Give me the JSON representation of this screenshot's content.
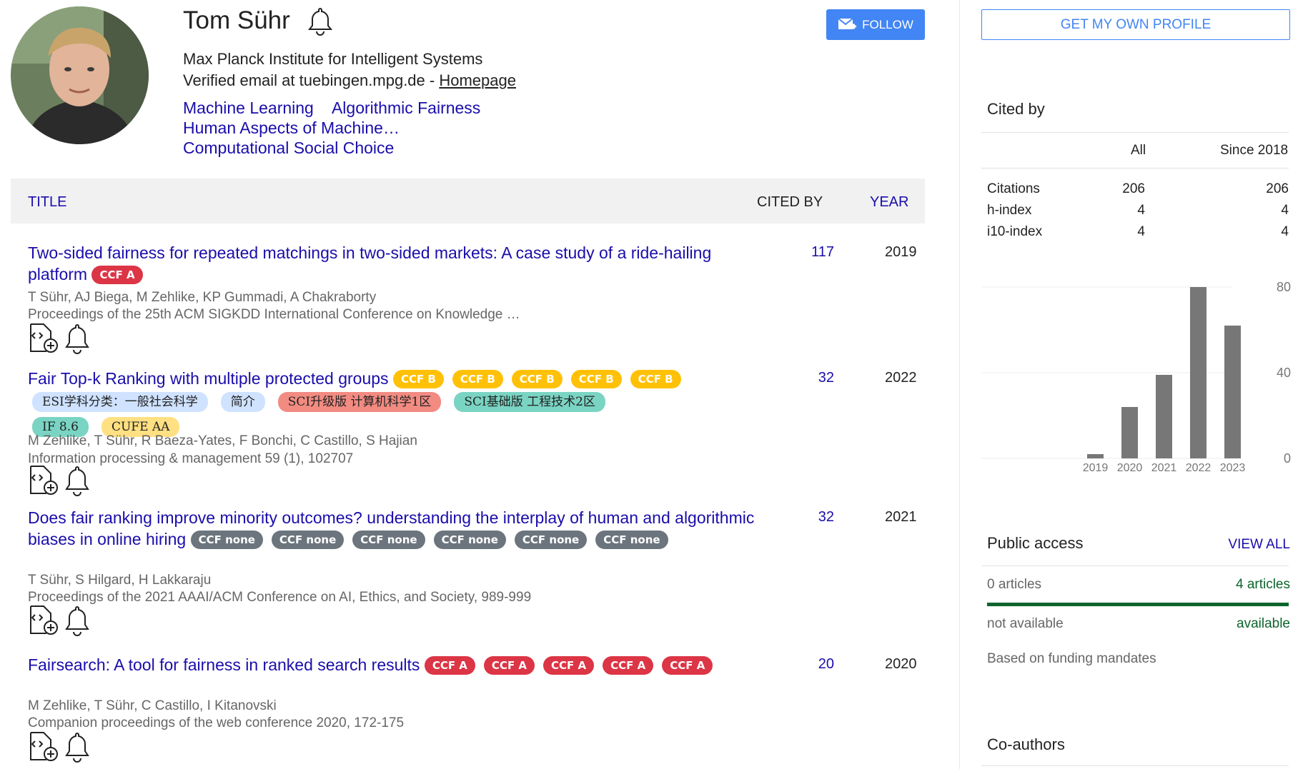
{
  "profile": {
    "name": "Tom Sühr",
    "affiliation": "Max Planck Institute for Intelligent Systems",
    "email_prefix": "Verified email at tuebingen.mpg.de - ",
    "homepage": "Homepage",
    "interests": [
      "Machine Learning",
      "Algorithmic Fairness",
      "Human Aspects of Machine…",
      "Computational Social Choice"
    ],
    "follow_label": "FOLLOW"
  },
  "table": {
    "col_title": "TITLE",
    "col_cited": "CITED BY",
    "col_year": "YEAR"
  },
  "articles": [
    {
      "title": "Two-sided fairness for repeated matchings in two-sided markets: A case study of a ride-hailing platform",
      "tags": [
        "CCF A"
      ],
      "authors": "T Sühr, AJ Biega, M Zehlike, KP Gummadi, A Chakraborty",
      "venue": "Proceedings of the 25th ACM SIGKDD International Conference on Knowledge …",
      "cited": "117",
      "year": "2019"
    },
    {
      "title": "Fair Top-k Ranking with multiple protected groups",
      "tags": [
        "CCF B",
        "CCF B",
        "CCF B",
        "CCF B",
        "CCF B"
      ],
      "pills": [
        "ESI学科分类：一般社会科学",
        "简介",
        "SCI升级版 计算机科学1区",
        "SCI基础版 工程技术2区",
        "IF 8.6",
        "CUFE AA"
      ],
      "authors": "M Zehlike, T Sühr, R Baeza-Yates, F Bonchi, C Castillo, S Hajian",
      "venue": "Information processing & management 59 (1), 102707",
      "cited": "32",
      "year": "2022"
    },
    {
      "title": "Does fair ranking improve minority outcomes? understanding the interplay of human and algorithmic biases in online hiring",
      "tags": [
        "CCF none",
        "CCF none",
        "CCF none",
        "CCF none",
        "CCF none",
        "CCF none"
      ],
      "authors": "T Sühr, S Hilgard, H Lakkaraju",
      "venue": "Proceedings of the 2021 AAAI/ACM Conference on AI, Ethics, and Society, 989-999",
      "cited": "32",
      "year": "2021"
    },
    {
      "title": "Fairsearch: A tool for fairness in ranked search results",
      "tags": [
        "CCF A",
        "CCF A",
        "CCF A",
        "CCF A",
        "CCF A"
      ],
      "authors": "M Zehlike, T Sühr, C Castillo, I Kitanovski",
      "venue": "Companion proceedings of the web conference 2020, 172-175",
      "cited": "20",
      "year": "2020"
    }
  ],
  "sidebar": {
    "own_profile": "GET MY OWN PROFILE",
    "cited_by": {
      "heading": "Cited by",
      "col_all": "All",
      "col_since": "Since 2018",
      "rows": [
        {
          "label": "Citations",
          "all": "206",
          "since": "206"
        },
        {
          "label": "h-index",
          "all": "4",
          "since": "4"
        },
        {
          "label": "i10-index",
          "all": "4",
          "since": "4"
        }
      ]
    },
    "public_access": {
      "heading": "Public access",
      "view_all": "VIEW ALL",
      "left_count": "0 articles",
      "right_count": "4 articles",
      "left_status": "not available",
      "right_status": "available",
      "note": "Based on funding mandates",
      "available_fraction": 1.0
    },
    "coauthors_heading": "Co-authors"
  },
  "chart_data": {
    "type": "bar",
    "categories": [
      "2019",
      "2020",
      "2021",
      "2022",
      "2023"
    ],
    "values": [
      2,
      24,
      39,
      80,
      62
    ],
    "ylim": [
      0,
      80
    ],
    "yticks": [
      "80",
      "40",
      "0"
    ],
    "bar_color": "#777777"
  }
}
